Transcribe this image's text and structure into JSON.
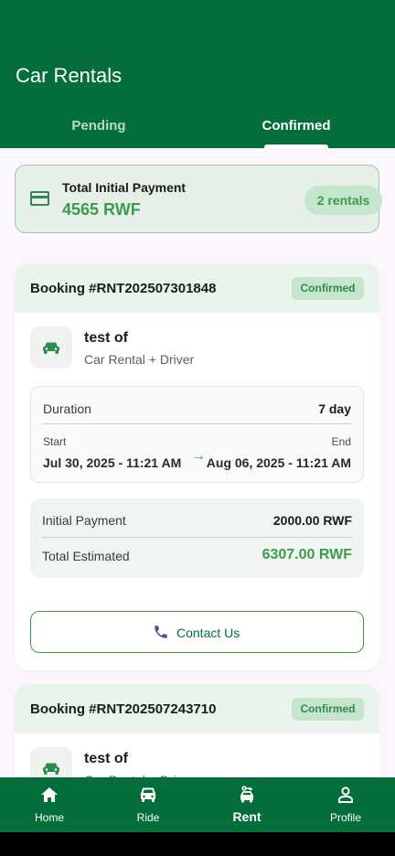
{
  "app_bar": {
    "title": "Car Rentals",
    "tabs": [
      {
        "label": "Pending",
        "active": false
      },
      {
        "label": "Confirmed",
        "active": true
      }
    ]
  },
  "summary": {
    "label": "Total Initial Payment",
    "amount": "4565 RWF",
    "count_badge": "2 rentals",
    "icon": "credit-card-icon"
  },
  "bookings": [
    {
      "id": "Booking #RNT202507301848",
      "status": "Confirmed",
      "vehicle": "test of",
      "service": "Car Rental + Driver",
      "duration_label": "Duration",
      "duration_value": "7 day",
      "start_label": "Start",
      "start_value": "Jul 30, 2025 - 11:21 AM",
      "end_label": "End",
      "end_value": "Aug 06, 2025 - 11:21 AM",
      "initial_payment_label": "Initial Payment",
      "initial_payment_value": "2000.00 RWF",
      "total_estimated_label": "Total Estimated",
      "total_estimated_value": "6307.00 RWF",
      "contact_label": "Contact Us"
    },
    {
      "id": "Booking #RNT202507243710",
      "status": "Confirmed",
      "vehicle": "test of",
      "service": "Car Rental + Driver"
    }
  ],
  "bottom_nav": [
    {
      "label": "Home",
      "icon": "home-icon",
      "active": false
    },
    {
      "label": "Ride",
      "icon": "car-icon",
      "active": false
    },
    {
      "label": "Rent",
      "icon": "car-rental-icon",
      "active": true
    },
    {
      "label": "Profile",
      "icon": "person-icon",
      "active": false
    }
  ],
  "colors": {
    "primary": "#046E3B",
    "accent": "#3E9A4F",
    "badge_bg": "#C6E5CE",
    "background": "#FDF7FD"
  }
}
